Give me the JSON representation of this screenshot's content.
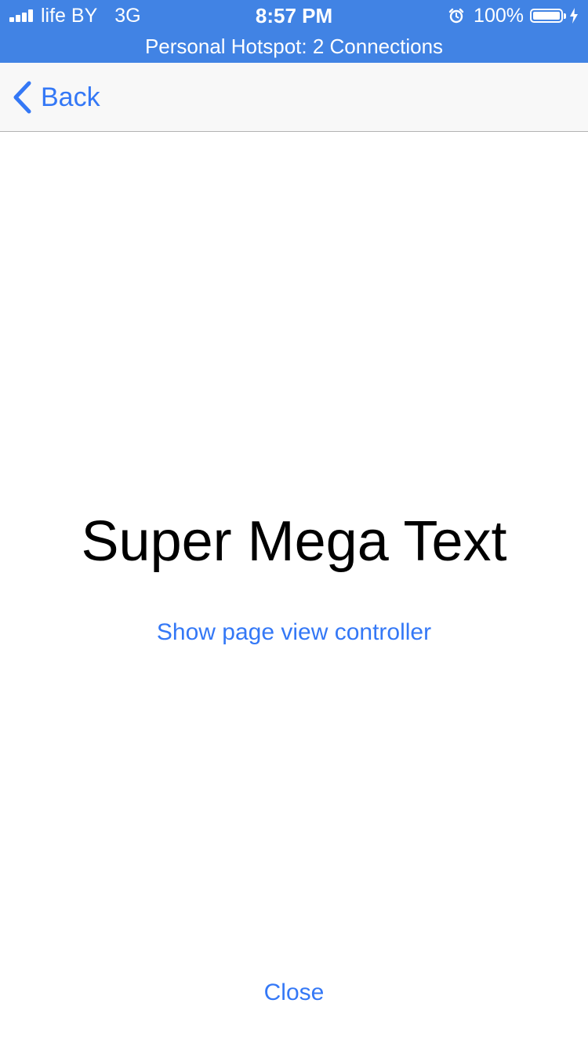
{
  "status_bar": {
    "carrier": "life BY",
    "network": "3G",
    "time": "8:57 PM",
    "battery": "100%",
    "hotspot": "Personal Hotspot: 2 Connections",
    "background_color": "#4183e4"
  },
  "nav": {
    "back_label": "Back",
    "accent_color": "#3478f6"
  },
  "content": {
    "title": "Super Mega Text",
    "link_label": "Show page view controller",
    "close_label": "Close"
  },
  "icons": {
    "signal": "signal-strength-icon",
    "alarm": "alarm-clock-icon",
    "battery": "battery-icon",
    "charging": "charging-bolt-icon",
    "back": "chevron-left-icon"
  }
}
